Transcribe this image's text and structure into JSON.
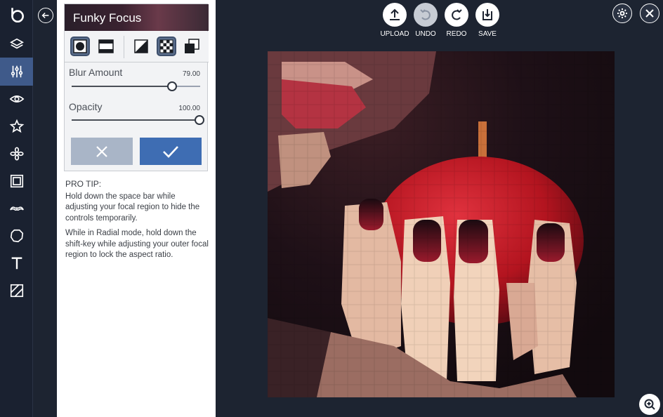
{
  "panel": {
    "title": "Funky Focus",
    "sliders": [
      {
        "label": "Blur Amount",
        "value_text": "79.00",
        "value": 79
      },
      {
        "label": "Opacity",
        "value_text": "100.00",
        "value": 100
      }
    ]
  },
  "tip": {
    "heading": "PRO TIP:",
    "paragraphs": [
      "Hold down the space bar while adjusting your focal region to hide the controls temporarily.",
      "While in Radial mode, hold down the shift-key while adjusting your outer focal region to lock the aspect ratio."
    ]
  },
  "toolbar": {
    "upload": "UPLOAD",
    "undo": "UNDO",
    "redo": "REDO",
    "save": "SAVE"
  },
  "colors": {
    "accent": "#3e6db3",
    "rail_active": "#3f5a8a",
    "background": "#1d2431"
  },
  "icons": [
    "logo-icon",
    "layers-icon",
    "adjust-icon",
    "eye-icon",
    "star-icon",
    "flower-icon",
    "frame-icon",
    "mustache-icon",
    "shape-icon",
    "text-icon",
    "texture-icon"
  ]
}
